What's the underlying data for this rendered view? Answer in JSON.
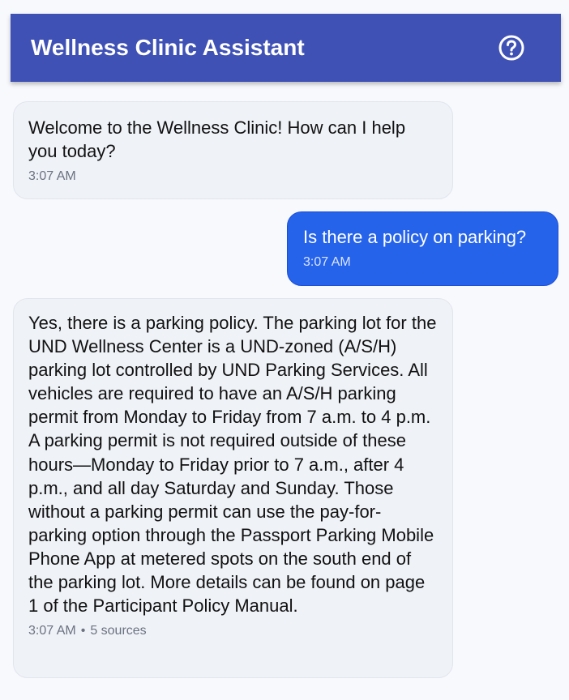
{
  "header": {
    "title": "Wellness Clinic Assistant",
    "help_icon": "help-circle-icon",
    "color": "#3f51b5"
  },
  "messages": [
    {
      "role": "assistant",
      "text": "Welcome to the Wellness Clinic! How can I help you today?",
      "time": "3:07 AM"
    },
    {
      "role": "user",
      "text": "Is there a policy on parking?",
      "time": "3:07 AM"
    },
    {
      "role": "assistant",
      "text": "Yes, there is a parking policy. The parking lot for the UND Wellness Center is a UND-zoned (A/S/H) parking lot controlled by UND Parking Services. All vehicles are required to have an A/S/H parking permit from Monday to Friday from 7 a.m. to 4 p.m. A parking permit is not required outside of these hours—Monday to Friday prior to 7 a.m., after 4 p.m., and all day Saturday and Sunday. Those without a parking permit can use the pay-for-parking option through the Passport Parking Mobile Phone App at metered spots on the south end of the parking lot. More details can be found on page 1 of the Participant Policy Manual.",
      "time": "3:07 AM",
      "separator": "•",
      "sources": "5 sources"
    }
  ],
  "colors": {
    "user_bubble": "#2563eb",
    "assistant_bubble": "#eff2f7",
    "background": "#f8f9fc"
  }
}
